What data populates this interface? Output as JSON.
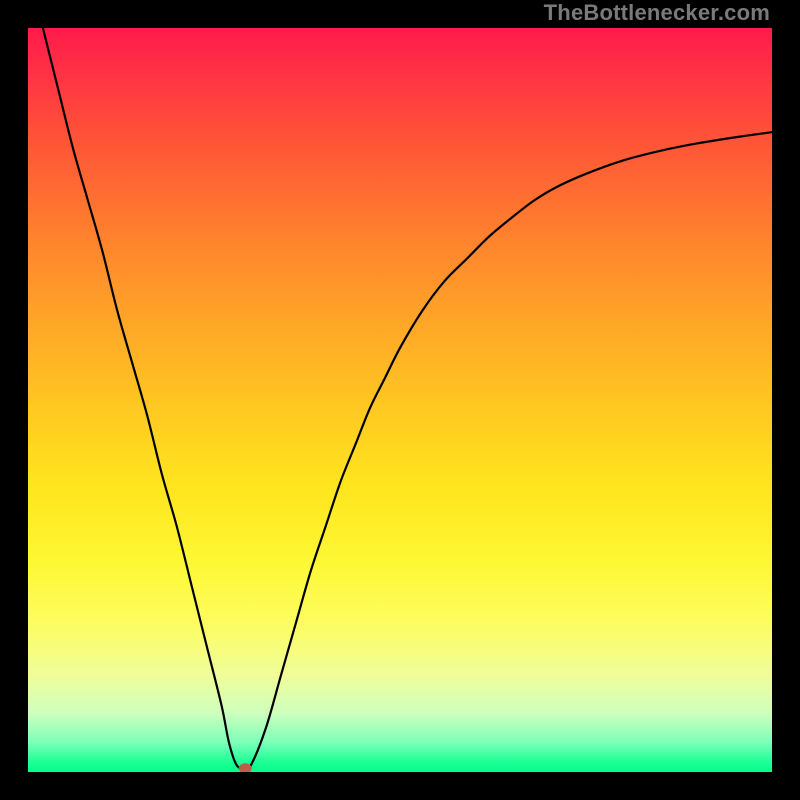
{
  "watermark": "TheBottlenecker.com",
  "chart_data": {
    "type": "line",
    "title": "",
    "xlabel": "",
    "ylabel": "",
    "xlim": [
      0,
      100
    ],
    "ylim": [
      0,
      100
    ],
    "series": [
      {
        "name": "bottleneck-curve",
        "x": [
          2,
          4,
          6,
          8,
          10,
          12,
          14,
          16,
          18,
          20,
          22,
          24,
          26,
          27,
          28,
          29,
          30,
          32,
          34,
          36,
          38,
          40,
          42,
          44,
          46,
          48,
          50,
          53,
          56,
          59,
          62,
          65,
          68,
          71,
          75,
          80,
          85,
          90,
          95,
          100
        ],
        "y": [
          100,
          92,
          84,
          77,
          70,
          62,
          55,
          48,
          40,
          33,
          25,
          17,
          9,
          4,
          1,
          0.5,
          1,
          6,
          13,
          20,
          27,
          33,
          39,
          44,
          49,
          53,
          57,
          62,
          66,
          69,
          72,
          74.5,
          76.8,
          78.6,
          80.4,
          82.2,
          83.5,
          84.5,
          85.3,
          86
        ]
      }
    ],
    "marker": {
      "x": 29.2,
      "y": 0.5
    },
    "gradient": {
      "top": "#ff1a4b",
      "mid": "#ffe61e",
      "bottom": "#00ff88"
    }
  }
}
